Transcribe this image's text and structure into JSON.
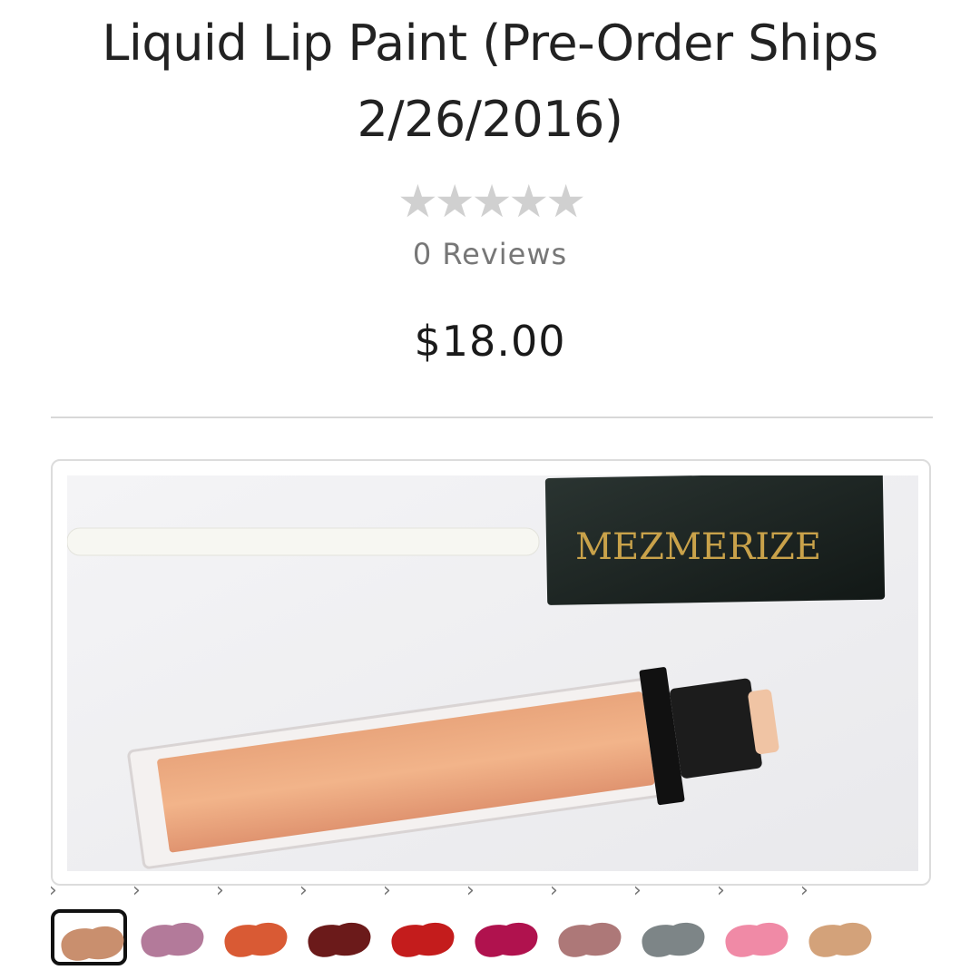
{
  "product": {
    "title_line1": "Liquid Lip Paint (Pre-Order Ships",
    "title_line2": "2/26/2016)",
    "stars": "★★★★★",
    "rating": 0,
    "reviews_label": "0 Reviews",
    "price": "$18.00"
  },
  "image": {
    "brand_text": "MEZMERIZE",
    "description": "product-photo"
  },
  "swatches": [
    {
      "color": "#c98f6e",
      "selected": true
    },
    {
      "color": "#b37a9a",
      "selected": false
    },
    {
      "color": "#d95a34",
      "selected": false
    },
    {
      "color": "#6b1a1a",
      "selected": false
    },
    {
      "color": "#c41c1c",
      "selected": false
    },
    {
      "color": "#b0124e",
      "selected": false
    },
    {
      "color": "#ad7878",
      "selected": false
    },
    {
      "color": "#7d8587",
      "selected": false
    },
    {
      "color": "#f08aa6",
      "selected": false
    },
    {
      "color": "#d3a27a",
      "selected": false
    }
  ],
  "swatch_arrow": "›"
}
